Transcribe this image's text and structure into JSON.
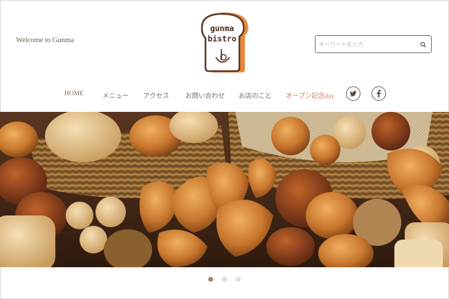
{
  "header": {
    "welcome_text": "Welcome to Gunma",
    "logo": {
      "line1": "gunma",
      "line2": "bistro"
    },
    "search": {
      "placeholder": "キーワードを入力",
      "value": "",
      "icon": "search-icon"
    }
  },
  "nav": {
    "items": [
      {
        "label": "HOME"
      },
      {
        "label": "メニュー"
      },
      {
        "label": "アクセス"
      },
      {
        "label": "お問い合わせ"
      },
      {
        "label": "お店のこと"
      },
      {
        "label": "オープン記念day"
      }
    ],
    "social": [
      {
        "icon": "twitter-icon"
      },
      {
        "icon": "facebook-icon"
      }
    ]
  },
  "hero": {
    "image": "bread-basket-photo"
  },
  "slider": {
    "slide_count": 3,
    "active_index": 0
  },
  "colors": {
    "text": "#7a6a5e",
    "accent": "#e0705a",
    "logo_orange": "#e8883a",
    "logo_brown": "#5a3a2a"
  }
}
